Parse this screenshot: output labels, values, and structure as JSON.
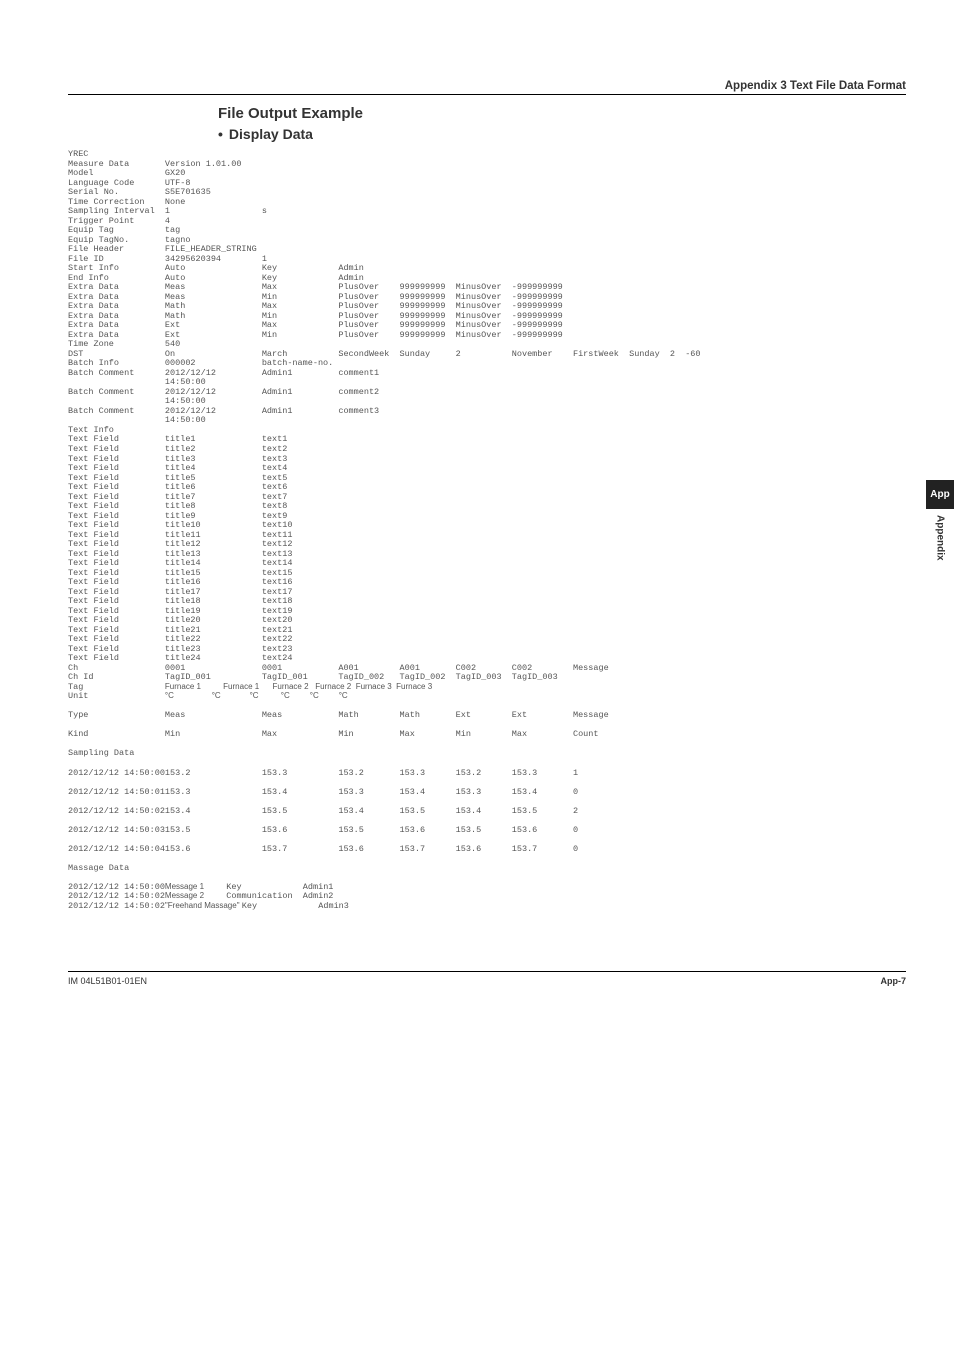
{
  "header": {
    "appendix_title": "Appendix 3 Text File Data Format"
  },
  "title": {
    "main": "File Output Example",
    "sub": "Display Data"
  },
  "sidebar": {
    "tab_short": "App",
    "tab_long": "Appendix"
  },
  "footer": {
    "left": "IM 04L51B01-01EN",
    "right": "App-7"
  },
  "meta_rows": [
    [
      "YREC"
    ],
    [
      "Measure Data",
      "Version 1.01.00"
    ],
    [
      "Model",
      "GX20"
    ],
    [
      "Language Code",
      "UTF-8"
    ],
    [
      "Serial No.",
      "S5E701635"
    ],
    [
      "Time Correction",
      "None"
    ],
    [
      "Sampling Interval",
      "1",
      "s"
    ],
    [
      "Trigger Point",
      "4"
    ],
    [
      "Equip Tag",
      "tag"
    ],
    [
      "Equip TagNo.",
      "tagno"
    ],
    [
      "File Header",
      "FILE_HEADER_STRING"
    ],
    [
      "File ID",
      "34295620394",
      "1"
    ],
    [
      "Start Info",
      "Auto",
      "Key",
      "Admin"
    ],
    [
      "End Info",
      "Auto",
      "Key",
      "Admin"
    ],
    [
      "Extra Data",
      "Meas",
      "Max",
      "PlusOver",
      "999999999",
      "MinusOver",
      "-999999999"
    ],
    [
      "Extra Data",
      "Meas",
      "Min",
      "PlusOver",
      "999999999",
      "MinusOver",
      "-999999999"
    ],
    [
      "Extra Data",
      "Math",
      "Max",
      "PlusOver",
      "999999999",
      "MinusOver",
      "-999999999"
    ],
    [
      "Extra Data",
      "Math",
      "Min",
      "PlusOver",
      "999999999",
      "MinusOver",
      "-999999999"
    ],
    [
      "Extra Data",
      "Ext",
      "Max",
      "PlusOver",
      "999999999",
      "MinusOver",
      "-999999999"
    ],
    [
      "Extra Data",
      "Ext",
      "Min",
      "PlusOver",
      "999999999",
      "MinusOver",
      "-999999999"
    ],
    [
      "Time Zone",
      "540"
    ],
    [
      "DST",
      "On",
      "March",
      "SecondWeek",
      "Sunday",
      "2",
      "November",
      "FirstWeek",
      "Sunday",
      "2",
      "-60"
    ],
    [
      "Batch Info",
      "000002",
      "batch-name-no."
    ],
    [
      "Batch Comment",
      "2012/12/12",
      "Admin1",
      "comment1"
    ],
    [
      "",
      "14:50:00"
    ],
    [
      "Batch Comment",
      "2012/12/12",
      "Admin1",
      "comment2"
    ],
    [
      "",
      "14:50:00"
    ],
    [
      "Batch Comment",
      "2012/12/12",
      "Admin1",
      "comment3"
    ],
    [
      "",
      "14:50:00"
    ],
    [
      "Text Info"
    ],
    [
      "Text Field",
      "title1",
      "text1"
    ],
    [
      "Text Field",
      "title2",
      "text2"
    ],
    [
      "Text Field",
      "title3",
      "text3"
    ],
    [
      "Text Field",
      "title4",
      "text4"
    ],
    [
      "Text Field",
      "title5",
      "text5"
    ],
    [
      "Text Field",
      "title6",
      "text6"
    ],
    [
      "Text Field",
      "title7",
      "text7"
    ],
    [
      "Text Field",
      "title8",
      "text8"
    ],
    [
      "Text Field",
      "title9",
      "text9"
    ],
    [
      "Text Field",
      "title10",
      "text10"
    ],
    [
      "Text Field",
      "title11",
      "text11"
    ],
    [
      "Text Field",
      "title12",
      "text12"
    ],
    [
      "Text Field",
      "title13",
      "text13"
    ],
    [
      "Text Field",
      "title14",
      "text14"
    ],
    [
      "Text Field",
      "title15",
      "text15"
    ],
    [
      "Text Field",
      "title16",
      "text16"
    ],
    [
      "Text Field",
      "title17",
      "text17"
    ],
    [
      "Text Field",
      "title18",
      "text18"
    ],
    [
      "Text Field",
      "title19",
      "text19"
    ],
    [
      "Text Field",
      "title20",
      "text20"
    ],
    [
      "Text Field",
      "title21",
      "text21"
    ],
    [
      "Text Field",
      "title22",
      "text22"
    ],
    [
      "Text Field",
      "title23",
      "text23"
    ],
    [
      "Text Field",
      "title24",
      "text24"
    ],
    [
      "Ch",
      "0001",
      "0001",
      "A001",
      "A001",
      "C002",
      "C002",
      "Message"
    ],
    [
      "Ch Id",
      "TagID_001",
      "TagID_001",
      "TagID_002",
      "TagID_002",
      "TagID_003",
      "TagID_003"
    ]
  ],
  "tag_row": [
    "Tag",
    "Furnace 1",
    "Furnace 1",
    "Furnace 2",
    "Furnace 2",
    "Furnace 3",
    "Furnace 3"
  ],
  "unit_row": [
    "Unit",
    "°C",
    "°C",
    "°C",
    "°C",
    "°C",
    "°C"
  ],
  "post_rows": [
    [
      "Type",
      "Meas",
      "Meas",
      "Math",
      "Math",
      "Ext",
      "Ext",
      "Message"
    ],
    [
      "Kind",
      "Min",
      "Max",
      "Min",
      "Max",
      "Min",
      "Max",
      "Count"
    ],
    [
      "Sampling Data"
    ],
    [
      "2012/12/12 14:50:00",
      "153.2",
      "153.3",
      "153.2",
      "153.3",
      "153.2",
      "153.3",
      "1"
    ],
    [
      "2012/12/12 14:50:01",
      "153.3",
      "153.4",
      "153.3",
      "153.4",
      "153.3",
      "153.4",
      "0"
    ],
    [
      "2012/12/12 14:50:02",
      "153.4",
      "153.5",
      "153.4",
      "153.5",
      "153.4",
      "153.5",
      "2"
    ],
    [
      "2012/12/12 14:50:03",
      "153.5",
      "153.6",
      "153.5",
      "153.6",
      "153.5",
      "153.6",
      "0"
    ],
    [
      "2012/12/12 14:50:04",
      "153.6",
      "153.7",
      "153.6",
      "153.7",
      "153.6",
      "153.7",
      "0"
    ],
    [
      "Massage Data"
    ]
  ],
  "msg_rows": [
    {
      "ts": "2012/12/12 14:50:00",
      "msg": "Message 1",
      "c3": "Key",
      "c4": "Admin1"
    },
    {
      "ts": "2012/12/12 14:50:02",
      "msg": "Message 2",
      "c3": "Communication",
      "c4": "Admin2"
    },
    {
      "ts": "2012/12/12 14:50:02",
      "msg": "\"Freehand Massage\"",
      "c3": "Key",
      "c4": "Admin3"
    }
  ]
}
